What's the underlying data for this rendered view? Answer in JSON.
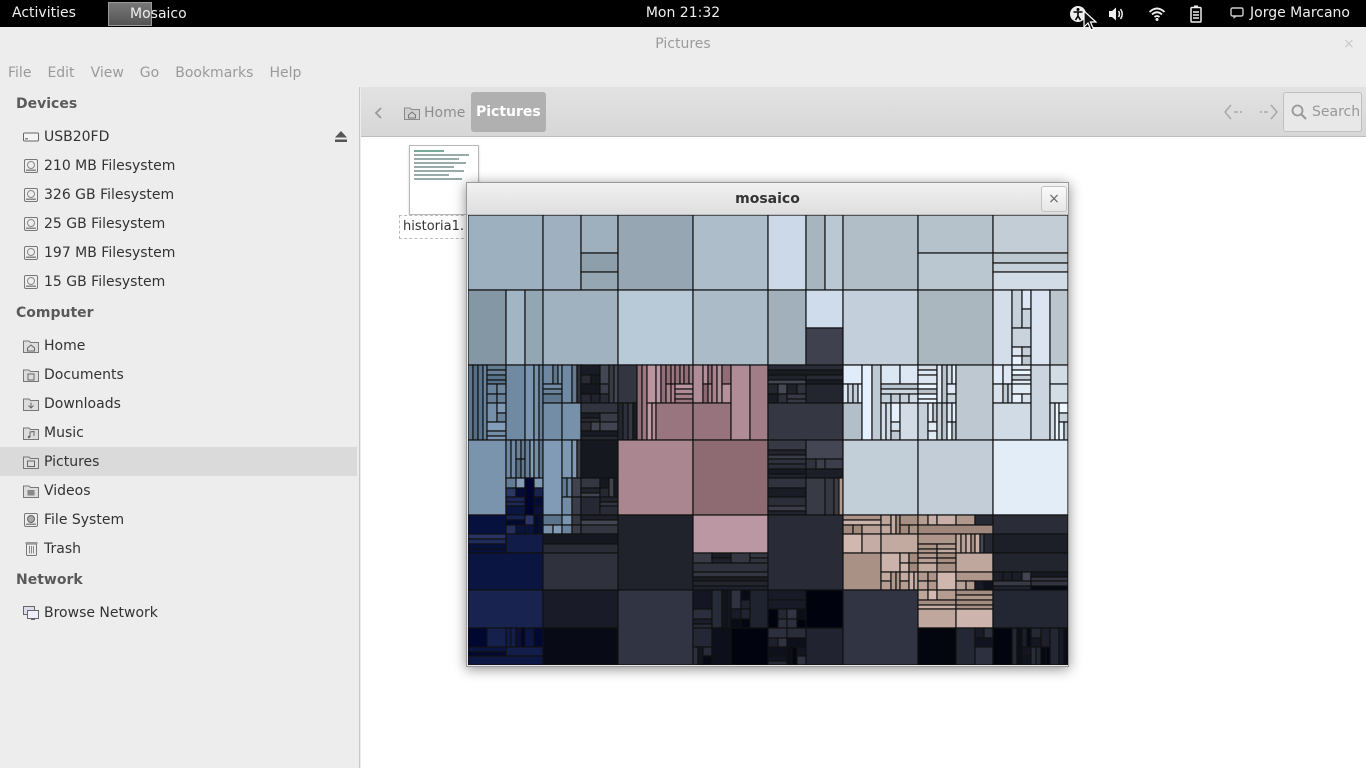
{
  "topbar": {
    "activities": "Activities",
    "app_name": "Mosaico",
    "clock": "Mon 21:32",
    "user": "Jorge Marcano"
  },
  "window": {
    "title": "Pictures",
    "close": "×"
  },
  "menubar": [
    "File",
    "Edit",
    "View",
    "Go",
    "Bookmarks",
    "Help"
  ],
  "sidebar": {
    "devices_title": "Devices",
    "devices": [
      "USB20FD",
      "210 MB Filesystem",
      "326 GB Filesystem",
      "25 GB Filesystem",
      "197 MB Filesystem",
      "15 GB Filesystem"
    ],
    "computer_title": "Computer",
    "computer": [
      "Home",
      "Documents",
      "Downloads",
      "Music",
      "Pictures",
      "Videos",
      "File System",
      "Trash"
    ],
    "network_title": "Network",
    "network": [
      "Browse Network"
    ],
    "selected": "Pictures"
  },
  "toolbar": {
    "crumb_home": "Home",
    "crumb_active": "Pictures",
    "search": "Search"
  },
  "files": [
    {
      "label": "historia1."
    }
  ],
  "dialog": {
    "title": "mosaico",
    "close": "×"
  }
}
